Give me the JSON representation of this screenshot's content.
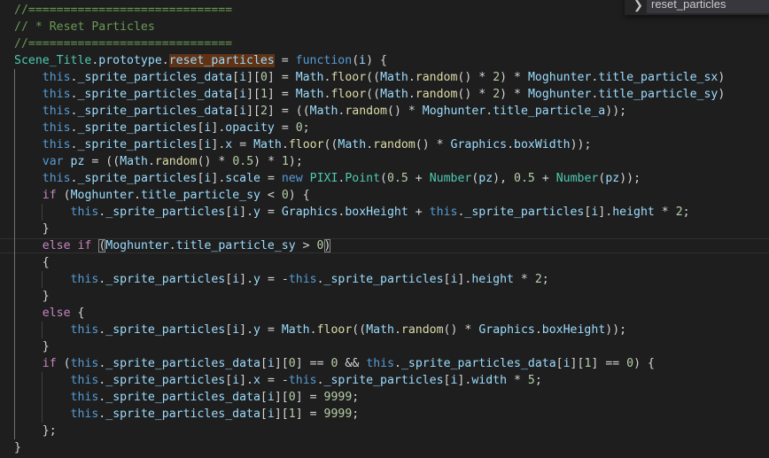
{
  "editor": {
    "language": "javascript",
    "lines": [
      "//=============================",
      "// * Reset Particles",
      "//=============================",
      "Scene_Title.prototype.reset_particles = function(i) {",
      "    this._sprite_particles_data[i][0] = Math.floor((Math.random() * 2) * Moghunter.title_particle_sx)",
      "    this._sprite_particles_data[i][1] = Math.floor((Math.random() * 2) * Moghunter.title_particle_sy)",
      "    this._sprite_particles_data[i][2] = ((Math.random() * Moghunter.title_particle_a));",
      "    this._sprite_particles[i].opacity = 0;",
      "    this._sprite_particles[i].x = Math.floor((Math.random() * Graphics.boxWidth));",
      "    var pz = ((Math.random() * 0.5) * 1);",
      "    this._sprite_particles[i].scale = new PIXI.Point(0.5 + Number(pz), 0.5 + Number(pz));",
      "    if (Moghunter.title_particle_sy < 0) {",
      "        this._sprite_particles[i].y = Graphics.boxHeight + this._sprite_particles[i].height * 2;",
      "    }",
      "    else if (Moghunter.title_particle_sy > 0)",
      "    {",
      "        this._sprite_particles[i].y = -this._sprite_particles[i].height * 2;",
      "    }",
      "    else {",
      "        this._sprite_particles[i].y = Math.floor((Math.random() * Graphics.boxHeight));",
      "    }",
      "    if (this._sprite_particles_data[i][0] == 0 && this._sprite_particles_data[i][1] == 0) {",
      "        this._sprite_particles[i].x = -this._sprite_particles[i].width * 5;",
      "        this._sprite_particles_data[i][0] = 9999;",
      "        this._sprite_particles_data[i][1] = 9999;",
      "    };",
      "}"
    ],
    "highlighted_word": "reset_particles",
    "current_line_index": 14
  },
  "breadcrumb_popup": {
    "chevron_icon": "chevron-right-icon",
    "item_label": "reset_particles"
  },
  "colors": {
    "background": "#1e1e1e",
    "comment": "#6a9955",
    "keyword": "#569cd6",
    "control_keyword": "#c586c0",
    "variable": "#9cdcfe",
    "function": "#dcdcaa",
    "type": "#4ec9b0",
    "number": "#b5cea8",
    "find_highlight": "#613214"
  }
}
